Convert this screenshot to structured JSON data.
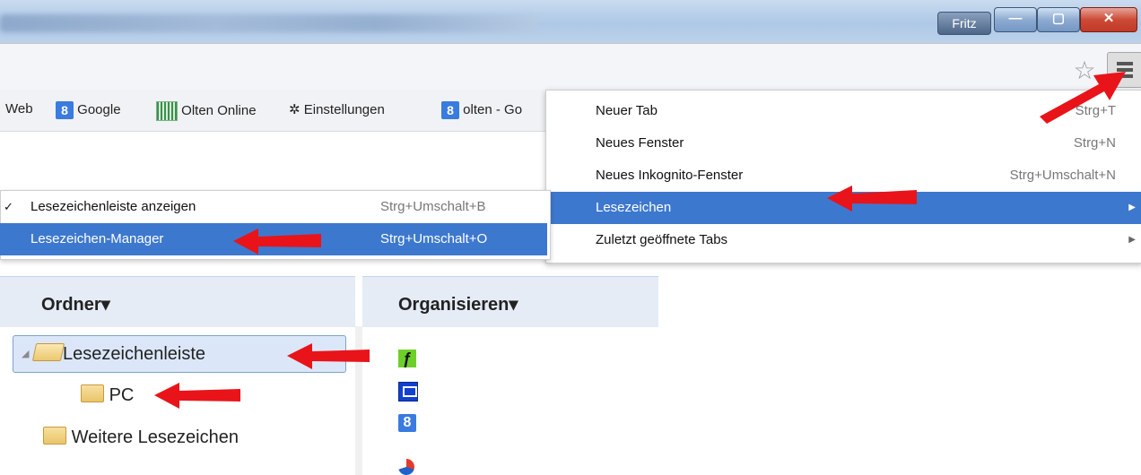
{
  "window": {
    "user_badge": "Fritz",
    "minimize_glyph": "—",
    "maximize_glyph": "▢",
    "close_glyph": "✕"
  },
  "toolbar": {
    "star_glyph": "☆",
    "menu_icon": "hamburger-menu-icon"
  },
  "bookmarks_bar": {
    "items": [
      {
        "label": "Web",
        "icon": ""
      },
      {
        "label": "Google",
        "icon": "google-icon"
      },
      {
        "label": "Olten Online",
        "icon": "olten-icon"
      },
      {
        "label": "Einstellungen",
        "icon": "gear-icon"
      },
      {
        "label": "olten - Go",
        "icon": "google-icon"
      }
    ],
    "gear_glyph": "✲",
    "google_glyph": "8"
  },
  "main_menu": {
    "items": [
      {
        "label": "Neuer Tab",
        "shortcut": "Strg+T"
      },
      {
        "label": "Neues Fenster",
        "shortcut": "Strg+N"
      },
      {
        "label": "Neues Inkognito-Fenster",
        "shortcut": "Strg+Umschalt+N"
      },
      {
        "label": "Lesezeichen",
        "shortcut": "",
        "submenu": true,
        "highlighted": true
      },
      {
        "label": "Zuletzt geöffnete Tabs",
        "shortcut": "",
        "submenu": true
      }
    ],
    "submenu_arrow": "▶"
  },
  "bookmarks_submenu": {
    "items": [
      {
        "label": "Lesezeichenleiste anzeigen",
        "shortcut": "Strg+Umschalt+B",
        "checked": true
      },
      {
        "label": "Lesezeichen-Manager",
        "shortcut": "Strg+Umschalt+O",
        "highlighted": true
      }
    ],
    "check_glyph": "✓"
  },
  "bookmark_manager": {
    "folders_header": "Ordner",
    "organize_header": "Organisieren",
    "dropdown_glyph": "▾",
    "tree": [
      {
        "label": "Lesezeichenleiste",
        "expanded": true,
        "selected": true
      },
      {
        "label": "PC",
        "level": 1
      },
      {
        "label": "Weitere Lesezeichen"
      }
    ],
    "expand_glyph": "◢",
    "leaf_glyph": "ƒ",
    "google_glyph": "8"
  },
  "colors": {
    "highlight": "#3d78cf",
    "arrow": "#e8141a",
    "header_bg": "#e5ecf6"
  }
}
